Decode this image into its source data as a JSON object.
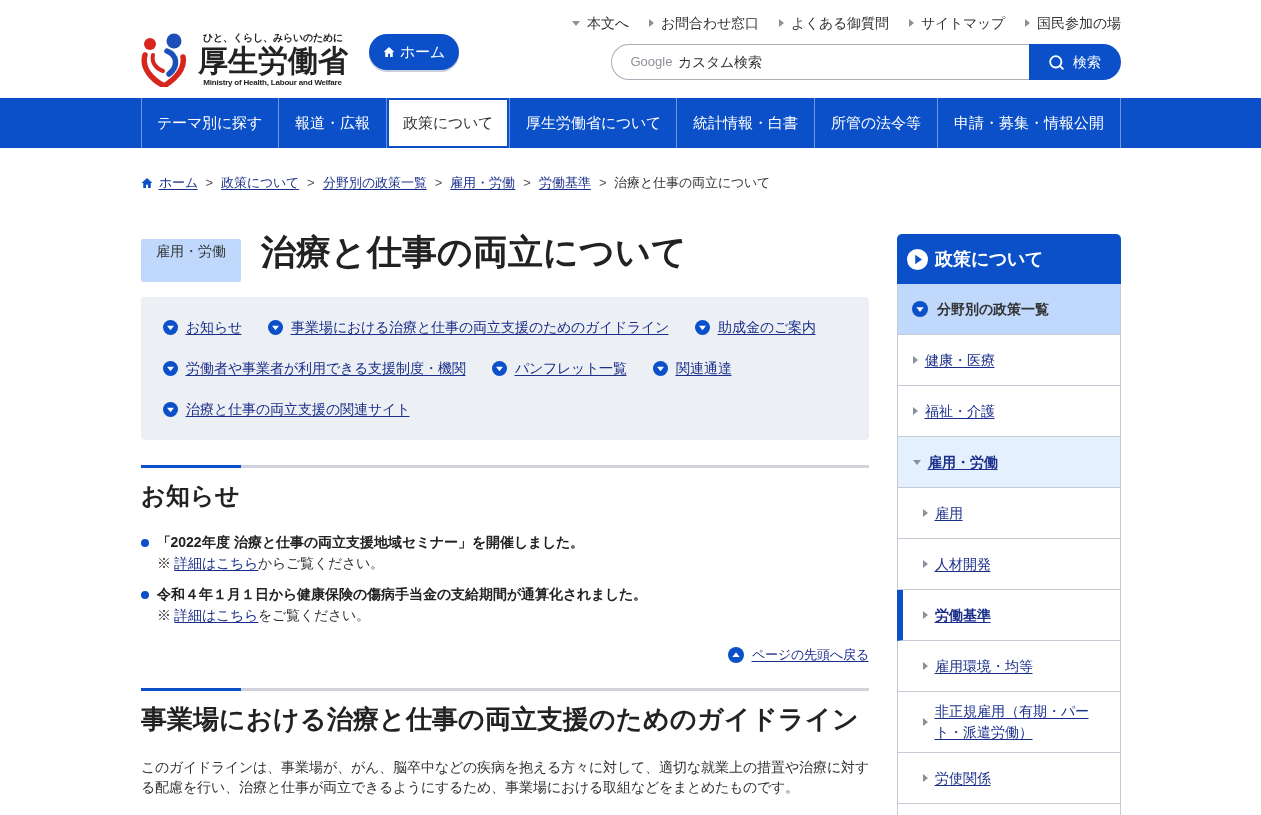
{
  "header": {
    "logo": {
      "tagline": "ひと、くらし、みらいのために",
      "name": "厚生労働省",
      "english": "Ministry of Health, Labour and Welfare"
    },
    "home_button": "ホーム",
    "utility_links": [
      {
        "label": "本文へ",
        "kind": "skip"
      },
      {
        "label": "お問合わせ窓口",
        "kind": "link"
      },
      {
        "label": "よくある御質問",
        "kind": "link"
      },
      {
        "label": "サイトマップ",
        "kind": "link"
      },
      {
        "label": "国民参加の場",
        "kind": "link"
      }
    ],
    "search": {
      "brand": "Google",
      "placeholder": "カスタム検索",
      "button": "検索"
    }
  },
  "nav": [
    {
      "label": "テーマ別に探す",
      "selected": false
    },
    {
      "label": "報道・広報",
      "selected": false
    },
    {
      "label": "政策について",
      "selected": true
    },
    {
      "label": "厚生労働省について",
      "selected": false
    },
    {
      "label": "統計情報・白書",
      "selected": false
    },
    {
      "label": "所管の法令等",
      "selected": false
    },
    {
      "label": "申請・募集・情報公開",
      "selected": false
    }
  ],
  "breadcrumb": {
    "separator": ">",
    "items": [
      {
        "label": "ホーム",
        "kind": "home"
      },
      {
        "label": "政策について",
        "kind": "link"
      },
      {
        "label": "分野別の政策一覧",
        "kind": "link"
      },
      {
        "label": "雇用・労働",
        "kind": "link"
      },
      {
        "label": "労働基準",
        "kind": "link"
      },
      {
        "label": "治療と仕事の両立について",
        "kind": "current"
      }
    ]
  },
  "page": {
    "category": "雇用・労働",
    "title": "治療と仕事の両立について"
  },
  "anchor_links": [
    "お知らせ",
    "事業場における治療と仕事の両立支援のためのガイドライン",
    "助成金のご案内",
    "労働者や事業者が利用できる支援制度・機関",
    "パンフレット一覧",
    "関連通達",
    "治療と仕事の両立支援の関連サイト"
  ],
  "notices": {
    "heading": "お知らせ",
    "items": [
      {
        "title": "「2022年度 治療と仕事の両立支援地域セミナー」を開催しました。",
        "note_prefix": "※",
        "note_link": "詳細はこちら",
        "note_suffix": "からご覧ください。"
      },
      {
        "title": "令和４年１月１日から健康保険の傷病手当金の支給期間が通算化されました。",
        "note_prefix": "※",
        "note_link": "詳細はこちら",
        "note_suffix": "をご覧ください。"
      }
    ],
    "back_to_top": "ページの先頭へ戻る"
  },
  "guideline": {
    "heading": "事業場における治療と仕事の両立支援のためのガイドライン",
    "paragraph": "このガイドラインは、事業場が、がん、脳卒中などの疾病を抱える方々に対して、適切な就業上の措置や治療に対する配慮を行い、治療と仕事が両立できるようにするため、事業場における取組などをまとめたものです。"
  },
  "sidebar": {
    "title": "政策について",
    "section": "分野別の政策一覧",
    "items": [
      {
        "label": "健康・医療",
        "expanded": false,
        "selected": false
      },
      {
        "label": "福祉・介護",
        "expanded": false,
        "selected": false
      },
      {
        "label": "雇用・労働",
        "expanded": true,
        "selected": false,
        "children": [
          {
            "label": "雇用",
            "selected": false
          },
          {
            "label": "人材開発",
            "selected": false
          },
          {
            "label": "労働基準",
            "selected": true
          },
          {
            "label": "雇用環境・均等",
            "selected": false
          },
          {
            "label": "非正規雇用（有期・パート・派遣労働）",
            "selected": false
          },
          {
            "label": "労使関係",
            "selected": false
          }
        ]
      }
    ]
  }
}
